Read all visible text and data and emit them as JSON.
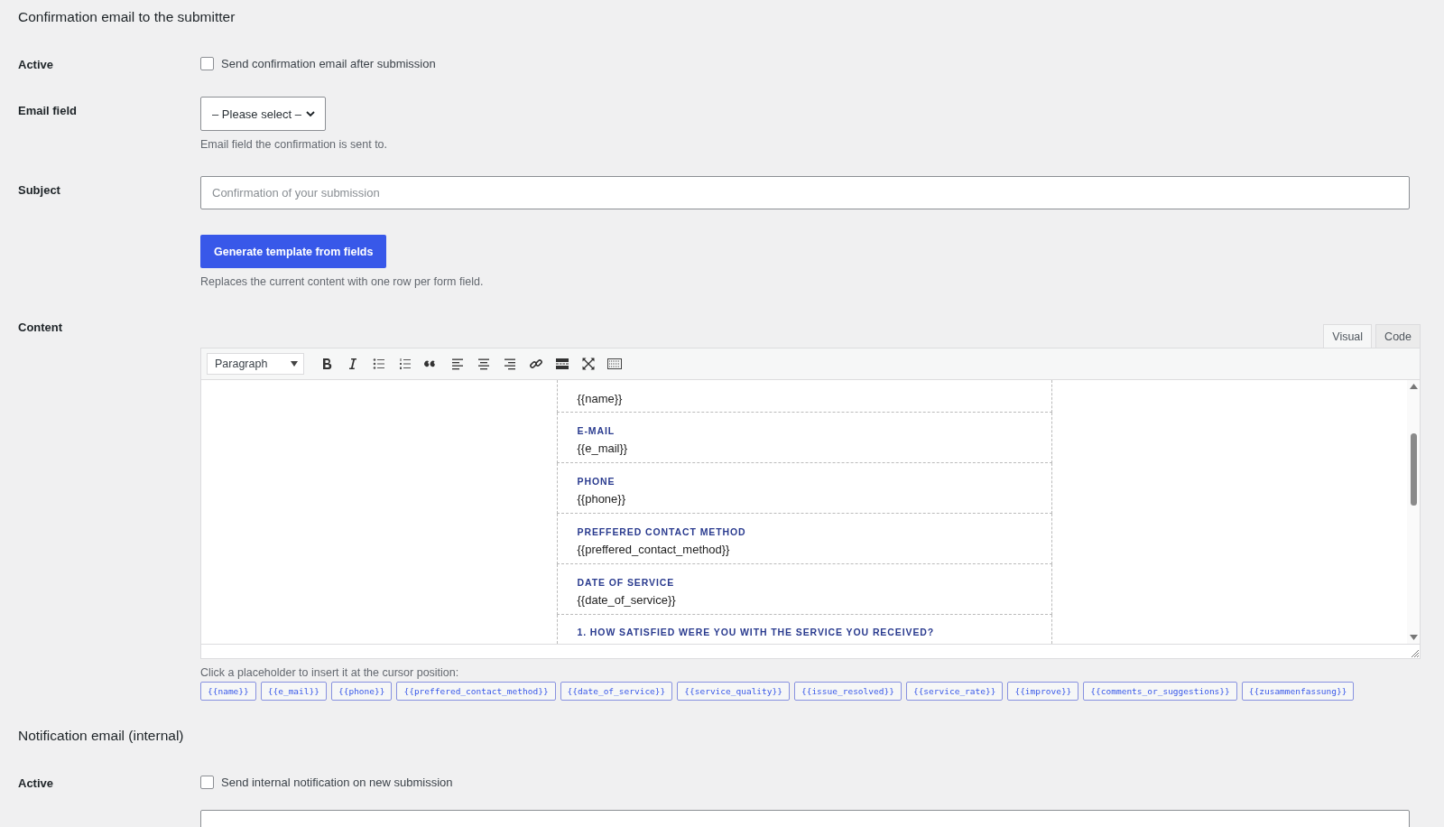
{
  "sections": [
    {
      "title": "Confirmation email to the submitter",
      "rows": [
        {
          "kind": "checkbox",
          "label": "Active",
          "text": "Send confirmation email after submission",
          "checked": false
        },
        {
          "kind": "select",
          "label": "Email field",
          "value": "– Please select –",
          "description": "Email field the confirmation is sent to."
        },
        {
          "kind": "text",
          "label": "Subject",
          "placeholder": "Confirmation of your submission"
        },
        {
          "kind": "button",
          "text": "Generate template from fields",
          "description": "Replaces the current content with one row per form field."
        },
        {
          "kind": "editor",
          "label": "Content",
          "tabs": [
            {
              "label": "Visual",
              "selected": true
            },
            {
              "label": "Code",
              "selected": false
            }
          ],
          "format": "Paragraph",
          "table": [
            {
              "value": "{{name}}"
            },
            {
              "heading": "E-MAIL",
              "value": "{{e_mail}}"
            },
            {
              "heading": "PHONE",
              "value": "{{phone}}"
            },
            {
              "heading": "PREFFERED CONTACT METHOD",
              "value": "{{preffered_contact_method}}"
            },
            {
              "heading": "DATE OF SERVICE",
              "value": "{{date_of_service}}"
            },
            {
              "heading": "1. HOW SATISFIED WERE YOU WITH THE SERVICE YOU RECEIVED?"
            }
          ],
          "hint": "Click a placeholder to insert it at the cursor position:",
          "placeholders": [
            "{{name}}",
            "{{e_mail}}",
            "{{phone}}",
            "{{preffered_contact_method}}",
            "{{date_of_service}}",
            "{{service_quality}}",
            "{{issue_resolved}}",
            "{{service_rate}}",
            "{{improve}}",
            "{{comments_or_suggestions}}",
            "{{zusammenfassung}}"
          ]
        }
      ]
    },
    {
      "title": "Notification email (internal)",
      "rows": [
        {
          "kind": "checkbox",
          "label": "Active",
          "text": "Send internal notification on new submission",
          "checked": false
        },
        {
          "kind": "text"
        }
      ]
    }
  ]
}
